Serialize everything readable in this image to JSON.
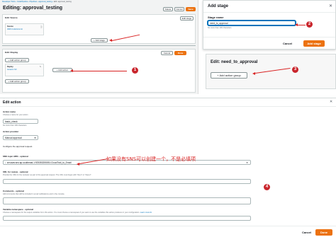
{
  "pipeline_screen": {
    "breadcrumb": [
      "Developer Tools",
      "CodePipeline",
      "Pipelines",
      "approval_testing",
      "Edit: approval_testing"
    ],
    "title": "Editing: approval_testing",
    "header_buttons": {
      "delete": "Delete",
      "cancel": "Cancel",
      "save": "Save"
    },
    "source_stage": {
      "title": "Edit: Source",
      "button": "Edit stage",
      "action_label": "Source",
      "action_sub": "AWS CodeCommit"
    },
    "add_stage_button": "+ Add stage",
    "display_stage": {
      "title": "Edit: Display",
      "cancel": "Cancel",
      "done": "Done",
      "add_action_group": "+ Add action group",
      "add_action": "+ Add action",
      "action_label": "Deploy",
      "action_sub": "Amazon S3"
    }
  },
  "add_stage_modal": {
    "title": "Add stage",
    "stage_name_label": "Stage name",
    "stage_name_value": "need_to_approval",
    "hint": "No more than 100 characters",
    "cancel": "Cancel",
    "submit": "Add stage"
  },
  "edit_stage_panel": {
    "title": "Edit: need_to_approval",
    "add_action_group": "Add action group"
  },
  "edit_action": {
    "title": "Edit action",
    "action_name_label": "Action name",
    "action_name_hint": "Choose a name for your action",
    "action_name_value": "basic_check",
    "action_name_counter": "No more than 100 characters",
    "action_provider_label": "Action provider",
    "action_provider_value": "Manual approval",
    "configure_text": "Configure the approval request.",
    "sns_label": "SNS topic ARN - optional",
    "sns_value": "arn:aws:sns:ap-southeast-1:925353255051:CloudTrail_to_Email",
    "annotation": "如果没有SNS可以创建一个，不是必填项",
    "url_label": "URL for review - optional",
    "url_hint": "Provide the URL for the reviewer as part of the approval request. The URL must begin with 'http://' or 'https://'.",
    "comments_label": "Comments - optional",
    "comments_hint": "Add comments that will be included in email notifications and in the console.",
    "ns_label": "Variable namespace - optional",
    "ns_hint": "Choose a namespace for the output variables from this action. You must choose a namespace if you want to use the variables this action produces in your configuration.",
    "learn_more": "Learn more",
    "cancel": "Cancel",
    "done": "Done"
  },
  "step_numbers": [
    "1",
    "2",
    "3",
    "4"
  ],
  "colors": {
    "accent": "#ec7211",
    "annotation_red": "#d92323",
    "badge": "#c9252c",
    "link": "#0073bb"
  }
}
